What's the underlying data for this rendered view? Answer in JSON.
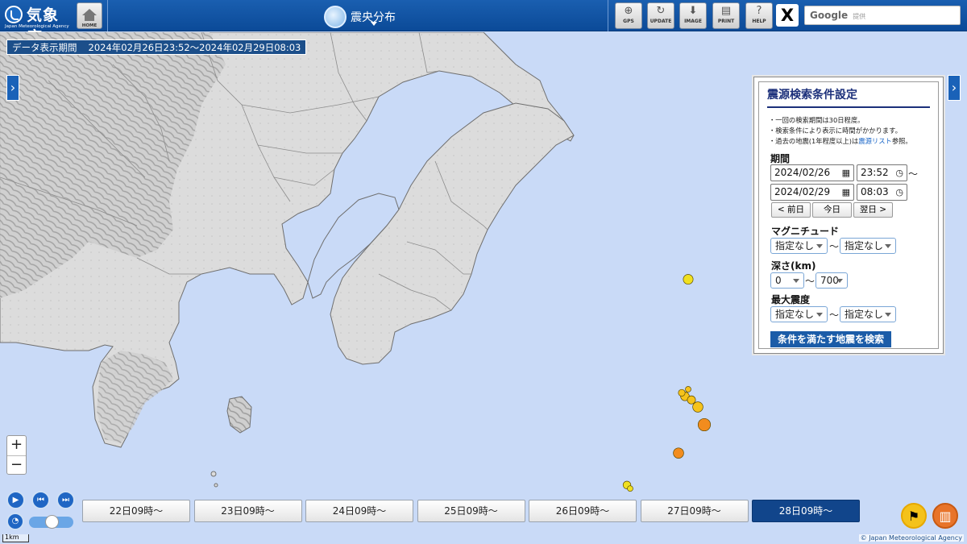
{
  "header": {
    "logo_title": "気象庁",
    "logo_sub": "Japan Meteorological Agency",
    "home_label": "HOME",
    "page_title": "震央分布",
    "tools": [
      {
        "name": "gps-button",
        "label": "GPS",
        "icon": "crosshair-icon"
      },
      {
        "name": "update-button",
        "label": "UPDATE",
        "icon": "refresh-icon"
      },
      {
        "name": "image-button",
        "label": "IMAGE",
        "icon": "download-icon"
      },
      {
        "name": "print-button",
        "label": "PRINT",
        "icon": "printer-icon"
      },
      {
        "name": "help-button",
        "label": "HELP",
        "icon": "question-icon"
      }
    ],
    "x_label": "X",
    "search_brand": "Google",
    "search_placeholder": "提供"
  },
  "period": {
    "label": "データ表示期間",
    "value": "2024年02月26日23:52～2024年02月29日08:03"
  },
  "panel": {
    "title": "震源検索条件設定",
    "notes": [
      "・一回の検索期間は30日程度。",
      "・検索条件により表示に時間がかかります。",
      "・過去の地震(1年程度以上)は"
    ],
    "note_link": "震源リスト",
    "note_tail": "参照。",
    "period_label": "期間",
    "start_date": "2024/02/26",
    "start_time": "23:52",
    "end_date": "2024/02/29",
    "end_time": "08:03",
    "tilde": "～",
    "prev_day": "< 前日",
    "today": "今日",
    "next_day": "翌日 >",
    "magnitude_label": "マグニチュード",
    "mag_min": "指定なし",
    "mag_max": "指定なし",
    "depth_label": "深さ(km)",
    "depth_min": "0",
    "depth_max": "700",
    "intensity_label": "最大震度",
    "int_min": "指定なし",
    "int_max": "指定なし",
    "search_button": "条件を満たす地震を検索"
  },
  "zoom": {
    "in": "+",
    "out": "−"
  },
  "timeline": [
    "22日09時～",
    "23日09時～",
    "24日09時～",
    "25日09時～",
    "26日09時～",
    "27日09時～",
    "28日09時～"
  ],
  "timeline_active": 6,
  "scale_label": "1km",
  "copyright": "© Japan Meteorological Agency",
  "colors": {
    "header": "#0b4a98",
    "sea": "#c9daf7",
    "land": "#d9d9d9",
    "active_time": "#11458b",
    "depth_shallow": "#e02020",
    "depth_10_20": "#f28c1e",
    "depth_20_30": "#f6c31c",
    "depth_30_50": "#f0e020",
    "depth_50_100": "#c8e030",
    "depth_100_150": "#20a040",
    "depth_150_plus": "#20c0b0"
  },
  "epicenters": [
    {
      "lon": 140.95,
      "lat": 35.13,
      "mag": 2.9,
      "depth": 20
    },
    {
      "lon": 140.94,
      "lat": 35.14,
      "mag": 2.5,
      "depth": 20
    },
    {
      "lon": 140.96,
      "lat": 35.15,
      "mag": 2.3,
      "depth": 25
    },
    {
      "lon": 140.97,
      "lat": 35.12,
      "mag": 2.8,
      "depth": 22
    },
    {
      "lon": 140.99,
      "lat": 35.1,
      "mag": 3.2,
      "depth": 20
    },
    {
      "lon": 141.01,
      "lat": 35.05,
      "mag": 3.6,
      "depth": 18
    },
    {
      "lon": 140.93,
      "lat": 34.97,
      "mag": 3.2,
      "depth": 10
    },
    {
      "lon": 140.77,
      "lat": 34.88,
      "mag": 2.7,
      "depth": 30
    },
    {
      "lon": 140.78,
      "lat": 34.87,
      "mag": 2.3,
      "depth": 32
    },
    {
      "lon": 140.96,
      "lat": 35.46,
      "mag": 3.1,
      "depth": 40
    }
  ]
}
